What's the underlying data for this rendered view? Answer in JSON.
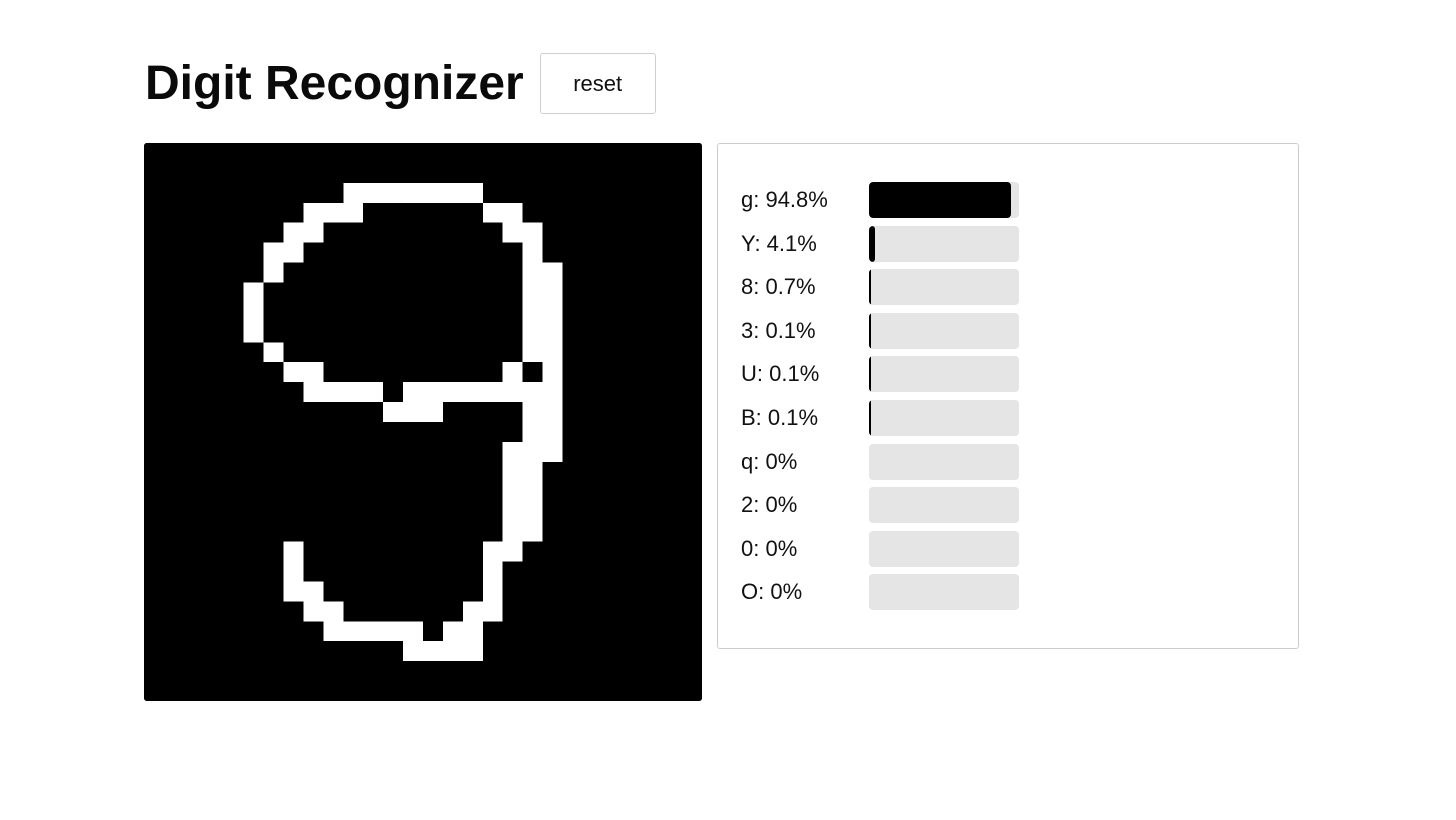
{
  "header": {
    "title": "Digit Recognizer",
    "reset_label": "reset"
  },
  "canvas": {
    "grid_size": 28,
    "background_color": "#000000",
    "stroke_color": "#ffffff",
    "pixels": [
      [
        10,
        2,
        7,
        1
      ],
      [
        8,
        3,
        3,
        1
      ],
      [
        17,
        3,
        2,
        1
      ],
      [
        7,
        4,
        2,
        1
      ],
      [
        18,
        4,
        2,
        1
      ],
      [
        6,
        5,
        2,
        1
      ],
      [
        19,
        5,
        1,
        1
      ],
      [
        6,
        6,
        1,
        1
      ],
      [
        19,
        6,
        2,
        1
      ],
      [
        5,
        7,
        1,
        3
      ],
      [
        19,
        7,
        1,
        4
      ],
      [
        20,
        7,
        1,
        9
      ],
      [
        6,
        10,
        1,
        1
      ],
      [
        7,
        11,
        2,
        1
      ],
      [
        18,
        11,
        1,
        1
      ],
      [
        8,
        12,
        4,
        1
      ],
      [
        15,
        12,
        4,
        1
      ],
      [
        13,
        12,
        2,
        1
      ],
      [
        12,
        13,
        3,
        1
      ],
      [
        19,
        12,
        1,
        8
      ],
      [
        18,
        15,
        1,
        6
      ],
      [
        7,
        20,
        1,
        3
      ],
      [
        8,
        22,
        1,
        1
      ],
      [
        17,
        20,
        1,
        3
      ],
      [
        8,
        23,
        2,
        1
      ],
      [
        16,
        23,
        2,
        1
      ],
      [
        9,
        24,
        5,
        1
      ],
      [
        15,
        24,
        2,
        1
      ],
      [
        13,
        25,
        4,
        1
      ]
    ]
  },
  "predictions": [
    {
      "label": "g: 94.8%",
      "value": 0.948
    },
    {
      "label": "Y: 4.1%",
      "value": 0.041
    },
    {
      "label": "8: 0.7%",
      "value": 0.007
    },
    {
      "label": "3: 0.1%",
      "value": 0.001
    },
    {
      "label": "U: 0.1%",
      "value": 0.001
    },
    {
      "label": "B: 0.1%",
      "value": 0.001
    },
    {
      "label": "q: 0%",
      "value": 0.0
    },
    {
      "label": "2: 0%",
      "value": 0.0
    },
    {
      "label": "0: 0%",
      "value": 0.0
    },
    {
      "label": "O: 0%",
      "value": 0.0
    }
  ]
}
